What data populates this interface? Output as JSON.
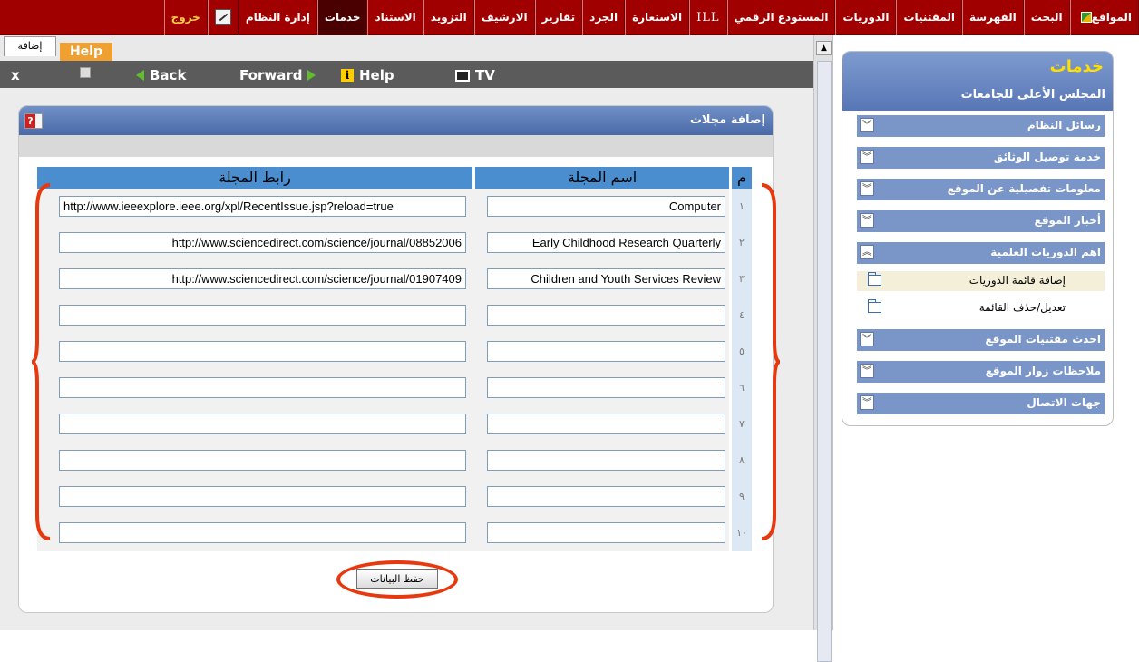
{
  "topbar": {
    "items": [
      {
        "id": "sites",
        "label": "المواقع"
      },
      {
        "id": "search",
        "label": "البحث"
      },
      {
        "id": "cataloging",
        "label": "الفهرسة"
      },
      {
        "id": "acquisitions",
        "label": "المقتنيات"
      },
      {
        "id": "periodicals",
        "label": "الدوريات"
      },
      {
        "id": "digital-repository",
        "label": "المستودع الرقمي"
      },
      {
        "id": "ill",
        "label": "ILL"
      },
      {
        "id": "circulation",
        "label": "الاستعارة"
      },
      {
        "id": "inventory",
        "label": "الجرد"
      },
      {
        "id": "reports",
        "label": "تقارير"
      },
      {
        "id": "archive",
        "label": "الارشيف"
      },
      {
        "id": "supply",
        "label": "التزويد"
      },
      {
        "id": "import",
        "label": "الاستناد"
      },
      {
        "id": "services",
        "label": "خدمات"
      },
      {
        "id": "system-admin",
        "label": "إدارة النظام"
      },
      {
        "id": "exit",
        "label": "خروج"
      }
    ],
    "active": "services"
  },
  "tabs": {
    "add": "إضافة",
    "help": "Help"
  },
  "toolbar": {
    "close": "x",
    "back": "Back",
    "forward": "Forward",
    "help": "Help",
    "tv": "TV"
  },
  "panel": {
    "title": "إضافة مجلات",
    "help_icon_text": "?",
    "columns": {
      "num": "م",
      "name": "اسم المجلة",
      "url": "رابط المجلة"
    },
    "rows": [
      {
        "num": "١",
        "name": "Computer",
        "url": "http://www.ieeexplore.ieee.org/xpl/RecentIssue.jsp?reload=true"
      },
      {
        "num": "٢",
        "name": "Early Childhood Research Quarterly",
        "url": "http://www.sciencedirect.com/science/journal/08852006"
      },
      {
        "num": "٣",
        "name": "Children and Youth Services Review",
        "url": "http://www.sciencedirect.com/science/journal/01907409"
      },
      {
        "num": "٤",
        "name": "",
        "url": ""
      },
      {
        "num": "٥",
        "name": "",
        "url": ""
      },
      {
        "num": "٦",
        "name": "",
        "url": ""
      },
      {
        "num": "٧",
        "name": "",
        "url": ""
      },
      {
        "num": "٨",
        "name": "",
        "url": ""
      },
      {
        "num": "٩",
        "name": "",
        "url": ""
      },
      {
        "num": "١٠",
        "name": "",
        "url": ""
      }
    ],
    "save_label": "حفظ البيانات"
  },
  "sidebar": {
    "title": "خدمات",
    "subtitle": "المجلس الأعلى للجامعات",
    "items": [
      {
        "label": "رسائل النظام",
        "chevron": "down"
      },
      {
        "label": "خدمة توصيل الوثائق",
        "chevron": "down"
      },
      {
        "label": "معلومات تفصيلية عن الموقع",
        "chevron": "down"
      },
      {
        "label": "أخبار الموقع",
        "chevron": "down"
      },
      {
        "label": "اهم الدوريات العلمية",
        "chevron": "up"
      },
      {
        "label": "احدث مقتنيات الموقع",
        "chevron": "down"
      },
      {
        "label": "ملاحظات زوار الموقع",
        "chevron": "down"
      },
      {
        "label": "جهات الاتصال",
        "chevron": "down"
      }
    ],
    "subitems": [
      {
        "label": "إضافة قائمة الدوريات",
        "highlighted": true
      },
      {
        "label": "تعديل/حذف القائمة",
        "highlighted": false
      }
    ]
  },
  "colors": {
    "topbar": "#a00000",
    "accent": "#4a8ed0",
    "annotation": "#e8380d",
    "sidebar_title": "#ffdf00"
  }
}
